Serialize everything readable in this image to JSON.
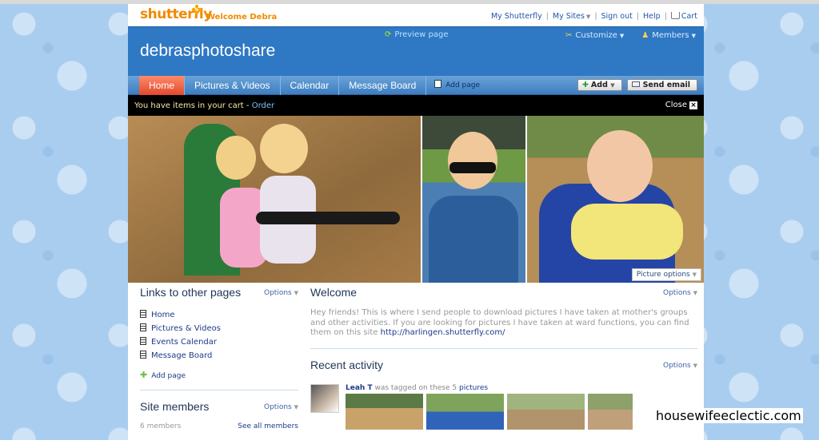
{
  "header": {
    "logo": "shutterfly",
    "welcome": "Welcome Debra",
    "links": [
      "My Shutterfly",
      "My Sites",
      "Sign out",
      "Help",
      "Cart"
    ]
  },
  "banner": {
    "site_title": "debrasphotoshare",
    "preview": "Preview page",
    "customize": "Customize",
    "members": "Members"
  },
  "nav": {
    "tabs": [
      "Home",
      "Pictures & Videos",
      "Calendar",
      "Message Board"
    ],
    "add_page": "Add page",
    "add_button": "Add",
    "send_email_button": "Send email"
  },
  "cart_bar": {
    "message": "You have items in your cart - ",
    "order": "Order",
    "close": "Close",
    "close_x": "×"
  },
  "photos": {
    "picture_options": "Picture options"
  },
  "left": {
    "links_title": "Links to other pages",
    "options": "Options",
    "links": [
      "Home",
      "Pictures & Videos",
      "Events Calendar",
      "Message Board"
    ],
    "add_page": "Add page",
    "members_title": "Site members",
    "members_count": "6 members",
    "see_all": "See all members"
  },
  "right": {
    "welcome_title": "Welcome",
    "options": "Options",
    "welcome_body": "Hey friends! This is where I send people to download pictures I have taken at mother's groups and other activities. If you are looking for pictures I have taken at ward functions, you can find them on this site ",
    "welcome_link": "http://harlingen.shutterfly.com/",
    "activity_title": "Recent activity",
    "activity_user": "Leah T",
    "activity_text": " was tagged on these 5 ",
    "activity_link": "pictures"
  },
  "watermark": "housewifeeclectic.com",
  "colors": {
    "banner": "#2f78c4",
    "active_tab": "#e2492e",
    "logo_orange": "#f08a00",
    "background": "#a9cdee"
  }
}
